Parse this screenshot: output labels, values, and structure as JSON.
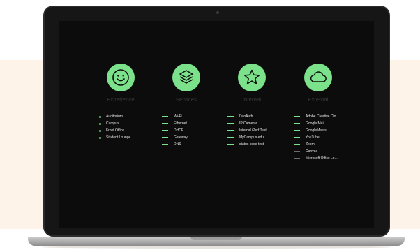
{
  "columns": [
    {
      "title": "Experience",
      "icon": "smiley-icon",
      "marker": "dot",
      "items": [
        {
          "label": "Auditorium",
          "status": "ok"
        },
        {
          "label": "Campus",
          "status": "ok"
        },
        {
          "label": "Front Office",
          "status": "ok"
        },
        {
          "label": "Student Lounge",
          "status": "ok"
        }
      ]
    },
    {
      "title": "Services",
      "icon": "layers-icon",
      "marker": "dash",
      "items": [
        {
          "label": "Wi-Fi",
          "status": "ok"
        },
        {
          "label": "Ethernet",
          "status": "ok"
        },
        {
          "label": "DHCP",
          "status": "ok"
        },
        {
          "label": "Gateway",
          "status": "ok"
        },
        {
          "label": "DNS",
          "status": "ok"
        }
      ]
    },
    {
      "title": "Internal",
      "icon": "star-icon",
      "marker": "dash",
      "items": [
        {
          "label": "DuoAuth",
          "status": "ok"
        },
        {
          "label": "IP Cameras",
          "status": "ok"
        },
        {
          "label": "Internal iPerf Test",
          "status": "ok"
        },
        {
          "label": "MyCampus.edu",
          "status": "ok"
        },
        {
          "label": "status code test",
          "status": "ok"
        }
      ]
    },
    {
      "title": "External",
      "icon": "cloud-icon",
      "marker": "dash",
      "items": [
        {
          "label": "Adobe Creative Clo...",
          "status": "ok"
        },
        {
          "label": "Google Mail",
          "status": "ok"
        },
        {
          "label": "GoogleMeets",
          "status": "ok"
        },
        {
          "label": "YouTube",
          "status": "ok"
        },
        {
          "label": "Zoom",
          "status": "ok"
        },
        {
          "label": "Canvas",
          "status": "unknown"
        },
        {
          "label": "Microsoft Office Lo...",
          "status": "unknown"
        }
      ]
    }
  ],
  "colors": {
    "accent": "#7be18a",
    "muted": "#6d6d6d",
    "screen_bg": "#0c0c0c"
  }
}
